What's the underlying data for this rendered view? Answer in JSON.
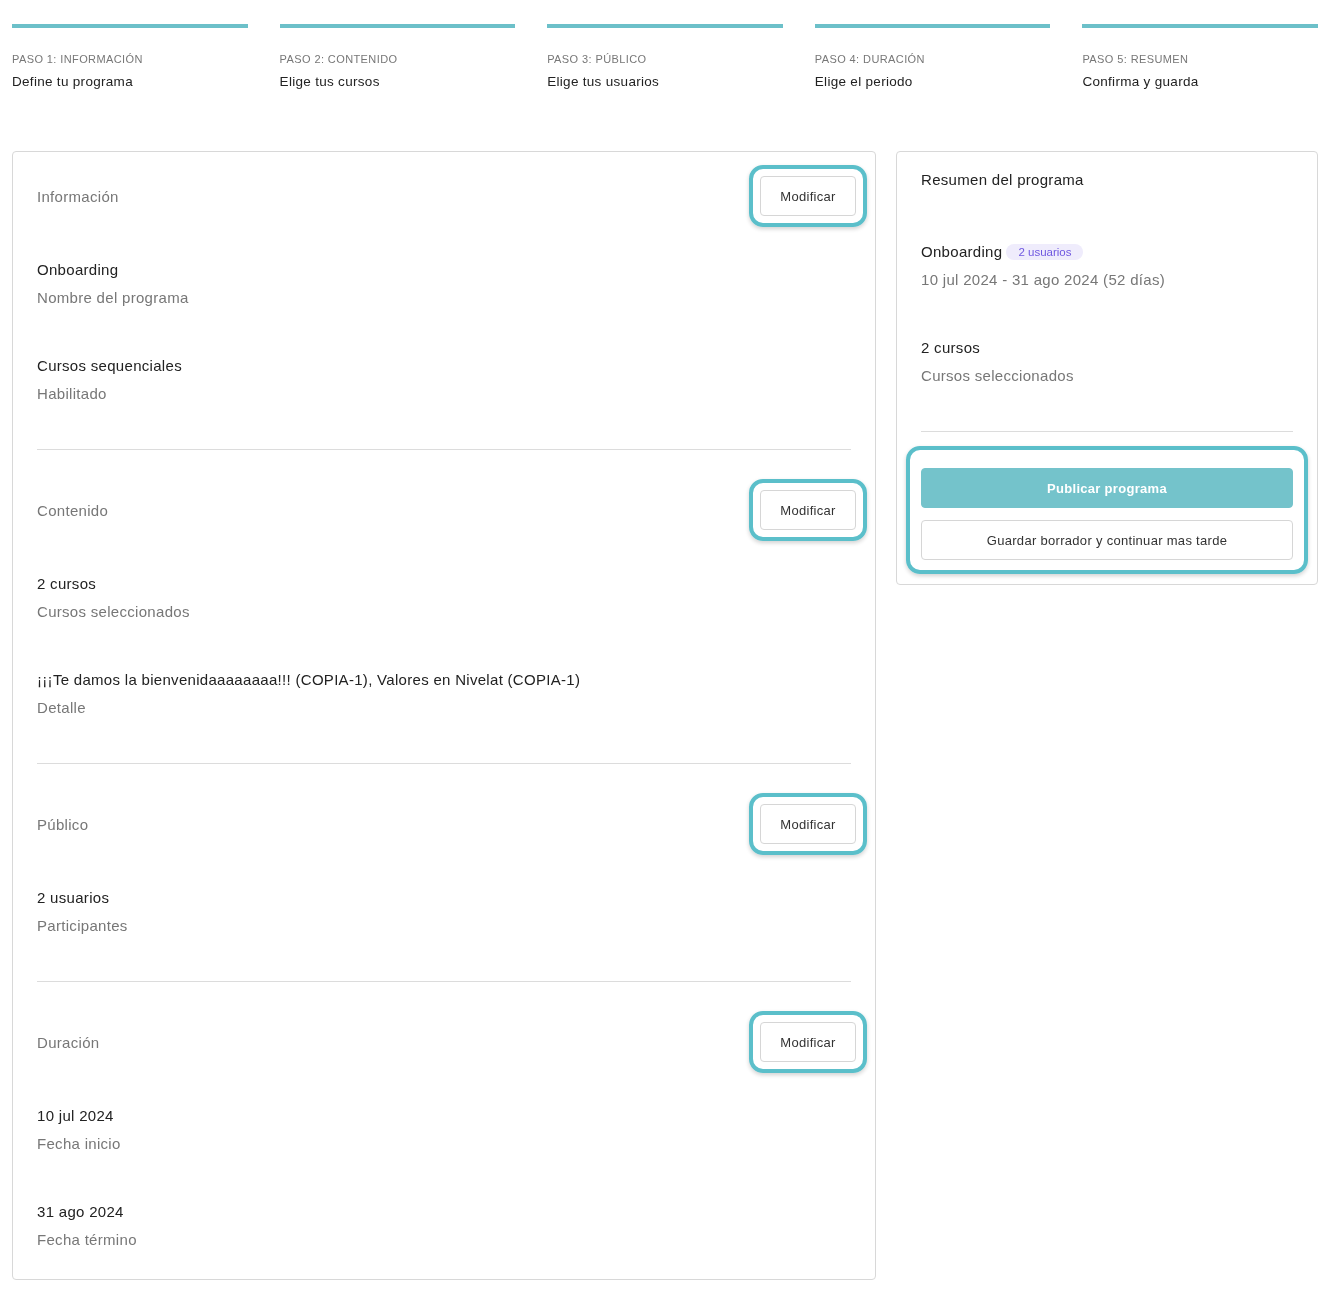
{
  "steps": [
    {
      "label": "PASO 1: INFORMACIÓN",
      "title": "Define tu programa",
      "done": true
    },
    {
      "label": "PASO 2: CONTENIDO",
      "title": "Elige tus cursos",
      "done": true
    },
    {
      "label": "PASO 3: PÚBLICO",
      "title": "Elige tus usuarios",
      "done": true
    },
    {
      "label": "PASO 4: DURACIÓN",
      "title": "Elige el periodo",
      "done": true
    },
    {
      "label": "PASO 5: RESUMEN",
      "title": "Confirma y guarda",
      "done": true
    }
  ],
  "sections": [
    {
      "title": "Información",
      "button": "Modificar",
      "highlighted": true,
      "fields": [
        {
          "value": "Onboarding",
          "label": "Nombre del programa"
        },
        {
          "value": "Cursos sequenciales",
          "label": "Habilitado"
        }
      ]
    },
    {
      "title": "Contenido",
      "button": "Modificar",
      "highlighted": true,
      "fields": [
        {
          "value": "2 cursos",
          "label": "Cursos seleccionados"
        },
        {
          "value": "¡¡¡Te damos la bienvenidaaaaaaaa!!! (COPIA-1), Valores en Nivelat (COPIA-1)",
          "label": "Detalle"
        }
      ]
    },
    {
      "title": "Público",
      "button": "Modificar",
      "highlighted": true,
      "fields": [
        {
          "value": "2 usuarios",
          "label": "Participantes"
        }
      ]
    },
    {
      "title": "Duración",
      "button": "Modificar",
      "highlighted": true,
      "fields": [
        {
          "value": "10 jul 2024",
          "label": "Fecha inicio"
        },
        {
          "value": "31 ago 2024",
          "label": "Fecha término"
        }
      ]
    }
  ],
  "summary": {
    "title": "Resumen del programa",
    "program": {
      "name": "Onboarding",
      "badge": "2 usuarios",
      "dates": "10 jul 2024 - 31 ago 2024 (52 días)"
    },
    "fields": [
      {
        "value": "2 cursos",
        "label": "Cursos seleccionados"
      }
    ],
    "actions_highlighted": true,
    "actions": [
      {
        "label": "Publicar programa",
        "kind": "primary"
      },
      {
        "label": "Guardar borrador y continuar mas tarde",
        "kind": "secondary"
      }
    ]
  }
}
